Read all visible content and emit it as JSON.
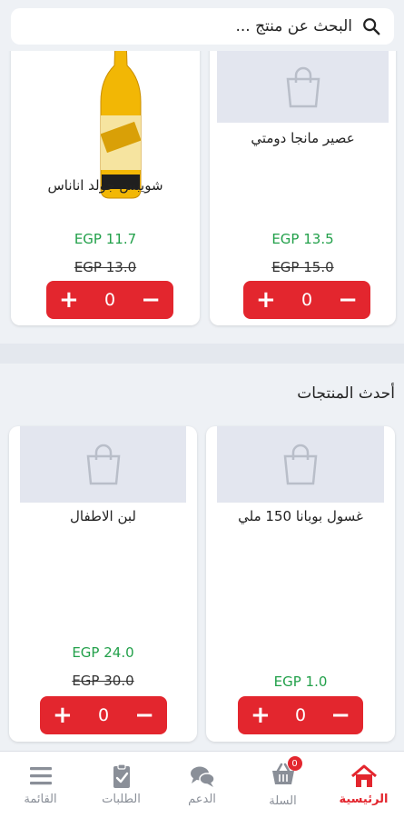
{
  "search": {
    "placeholder": "البحث عن منتج ..."
  },
  "top_products": [
    {
      "name": "عصير مانجا دومتي",
      "price": "EGP 13.5",
      "old_price": "EGP 15.0",
      "qty": "0",
      "has_image": false
    },
    {
      "name": "شويبس جولد اناناس",
      "price": "EGP 11.7",
      "old_price": "EGP 13.0",
      "qty": "0",
      "has_image": true
    }
  ],
  "latest": {
    "title": "أحدث المنتجات",
    "products": [
      {
        "name": "غسول بوبانا 150 ملي",
        "price": "EGP 1.0",
        "old_price": "",
        "qty": "0"
      },
      {
        "name": "لبن الاطفال",
        "price": "EGP 24.0",
        "old_price": "EGP 30.0",
        "qty": "0"
      }
    ]
  },
  "stepper": {
    "plus": "+",
    "minus": "−"
  },
  "nav": {
    "items": [
      {
        "label": "الرئيسية",
        "icon": "home-icon",
        "active": true
      },
      {
        "label": "السلة",
        "icon": "cart-icon",
        "badge": "0"
      },
      {
        "label": "الدعم",
        "icon": "chat-icon"
      },
      {
        "label": "الطلبات",
        "icon": "clipboard-icon"
      },
      {
        "label": "القائمة",
        "icon": "menu-icon"
      }
    ]
  },
  "colors": {
    "accent": "#e3262e",
    "price": "#22a04a",
    "placeholder_bg": "#e3e6ef"
  }
}
